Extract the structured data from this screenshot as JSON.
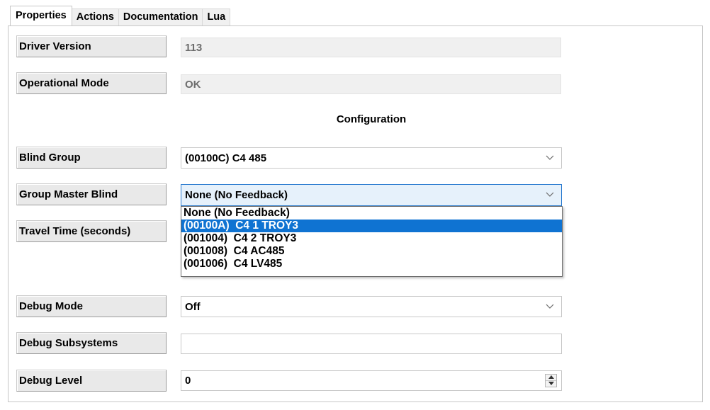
{
  "tabs": [
    {
      "label": "Properties"
    },
    {
      "label": "Actions"
    },
    {
      "label": "Documentation"
    },
    {
      "label": "Lua"
    }
  ],
  "properties": {
    "driver_version": {
      "label": "Driver Version",
      "value": "113"
    },
    "operational_mode": {
      "label": "Operational Mode",
      "value": "OK"
    },
    "section_heading": "Configuration",
    "blind_group": {
      "label": "Blind Group",
      "value": "(00100C)  C4 485"
    },
    "group_master_blind": {
      "label": "Group Master Blind",
      "value": "None (No Feedback)",
      "options": [
        "None (No Feedback)",
        "(00100A)  C4 1 TROY3",
        "(001004)  C4 2 TROY3",
        "(001008)  C4 AC485",
        "(001006)  C4 LV485"
      ],
      "highlighted_option": "(00100A)  C4 1 TROY3"
    },
    "travel_time": {
      "label": "Travel Time (seconds)"
    },
    "debug_mode": {
      "label": "Debug Mode",
      "value": "Off"
    },
    "debug_subsystems": {
      "label": "Debug Subsystems",
      "value": ""
    },
    "debug_level": {
      "label": "Debug Level",
      "value": "0"
    }
  },
  "icons": {
    "dropdown": "chevron-down-icon",
    "spinner_up": "arrow-up-icon",
    "spinner_down": "arrow-down-icon"
  },
  "colors": {
    "selection": "#0f73d2",
    "focus_border": "#2b7bd0",
    "focus_background": "#e6f1fb"
  }
}
